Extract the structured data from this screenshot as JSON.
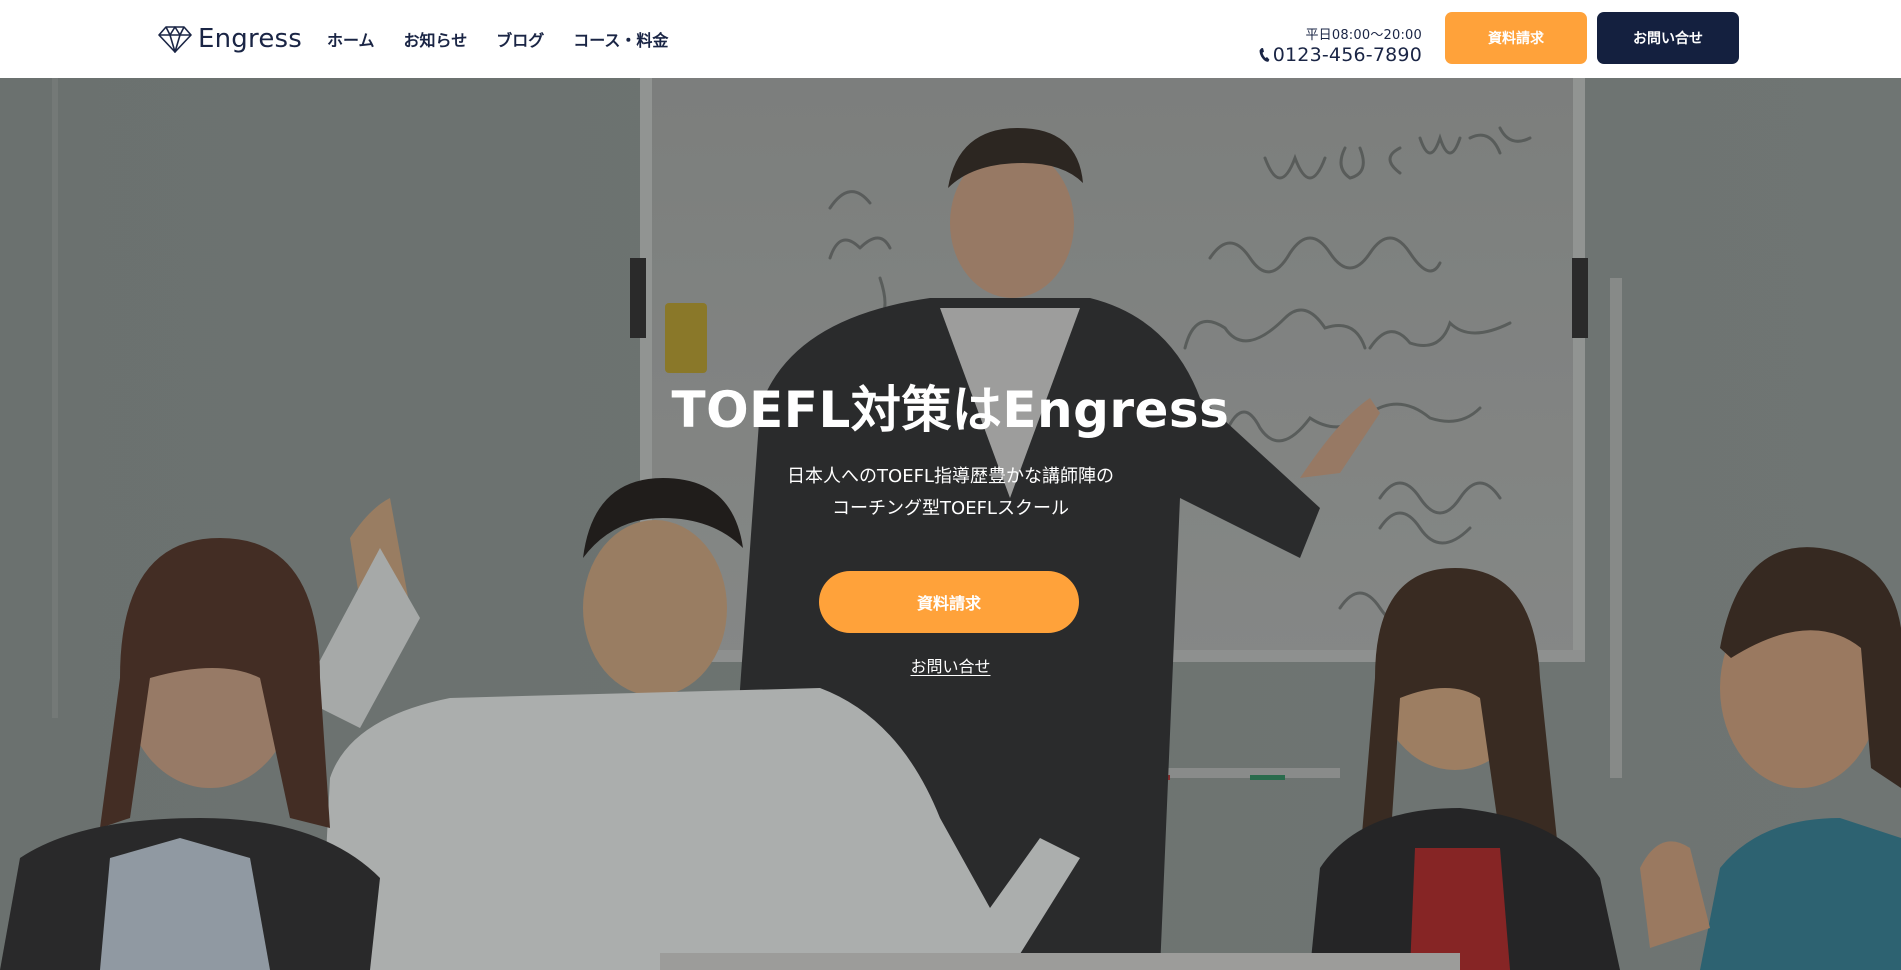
{
  "header": {
    "logo_text": "Engress",
    "nav": [
      "ホーム",
      "お知らせ",
      "ブログ",
      "コース・料金"
    ],
    "hours": "平日08:00〜20:00",
    "phone": "0123-456-7890",
    "btn_document": "資料請求",
    "btn_contact": "お問い合せ"
  },
  "hero": {
    "title": "TOEFL対策はEngress",
    "subtitle_line1": "日本人へのTOEFL指導歴豊かな講師陣の",
    "subtitle_line2": "コーチング型TOEFLスクール",
    "cta_button": "資料請求",
    "contact_link": "お問い合せ"
  },
  "colors": {
    "navy": "#14203f",
    "orange": "#ffa23a",
    "white": "#ffffff"
  },
  "icons": {
    "logo": "diamond-icon",
    "phone": "phone-icon"
  }
}
